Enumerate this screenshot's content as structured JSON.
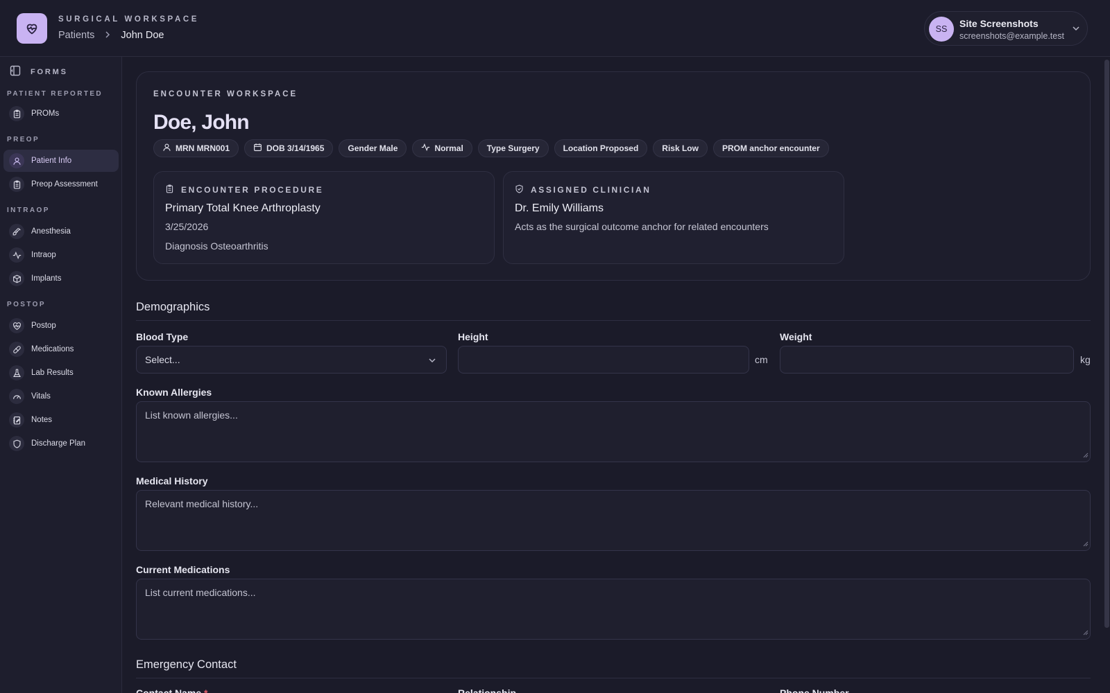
{
  "header": {
    "brand_sub": "SURGICAL WORKSPACE",
    "breadcrumb": [
      "Patients",
      "John Doe"
    ],
    "user": {
      "initials": "SS",
      "name": "Site Screenshots",
      "email": "screenshots@example.test"
    }
  },
  "sidebar": {
    "title": "FORMS",
    "sections": [
      {
        "label": "PATIENT REPORTED",
        "items": [
          {
            "label": "PROMs",
            "icon": "clipboard-icon"
          }
        ]
      },
      {
        "label": "PREOP",
        "items": [
          {
            "label": "Patient Info",
            "icon": "user-icon",
            "active": true
          },
          {
            "label": "Preop Assessment",
            "icon": "clipboard-icon"
          }
        ]
      },
      {
        "label": "INTRAOP",
        "items": [
          {
            "label": "Anesthesia",
            "icon": "syringe-icon"
          },
          {
            "label": "Intraop",
            "icon": "activity-icon"
          },
          {
            "label": "Implants",
            "icon": "box-icon"
          }
        ]
      },
      {
        "label": "POSTOP",
        "items": [
          {
            "label": "Postop",
            "icon": "heart-pulse-icon"
          },
          {
            "label": "Medications",
            "icon": "pill-icon"
          },
          {
            "label": "Lab Results",
            "icon": "flask-icon"
          },
          {
            "label": "Vitals",
            "icon": "gauge-icon"
          },
          {
            "label": "Notes",
            "icon": "notebook-icon"
          },
          {
            "label": "Discharge Plan",
            "icon": "shield-icon"
          }
        ]
      }
    ]
  },
  "encounter": {
    "eyebrow": "ENCOUNTER WORKSPACE",
    "patient_name": "Doe, John",
    "chips": {
      "mrn": "MRN MRN001",
      "dob": "DOB 3/14/1965",
      "gender": "Gender Male",
      "status": "Normal",
      "type": "Type Surgery",
      "location": "Location Proposed",
      "risk": "Risk Low",
      "prom": "PROM anchor encounter"
    },
    "procedure": {
      "eyebrow": "ENCOUNTER PROCEDURE",
      "name": "Primary Total Knee Arthroplasty",
      "date": "3/25/2026",
      "diagnosis": "Diagnosis Osteoarthritis"
    },
    "clinician": {
      "eyebrow": "ASSIGNED CLINICIAN",
      "name": "Dr. Emily Williams",
      "note": "Acts as the surgical outcome anchor for related encounters"
    }
  },
  "demographics": {
    "title": "Demographics",
    "blood_type": {
      "label": "Blood Type",
      "value": "Select..."
    },
    "height": {
      "label": "Height",
      "value": "",
      "unit": "cm"
    },
    "weight": {
      "label": "Weight",
      "value": "",
      "unit": "kg"
    },
    "allergies": {
      "label": "Known Allergies",
      "placeholder": "List known allergies..."
    },
    "history": {
      "label": "Medical History",
      "placeholder": "Relevant medical history..."
    },
    "medications": {
      "label": "Current Medications",
      "placeholder": "List current medications..."
    }
  },
  "emergency": {
    "title": "Emergency Contact",
    "contact_name_label": "Contact Name",
    "required_mark": "*",
    "relationship_label": "Relationship",
    "phone_label": "Phone Number"
  },
  "colors": {
    "accent": "#c9b3f2",
    "background": "#1b1b29",
    "required": "#e35d6a"
  }
}
